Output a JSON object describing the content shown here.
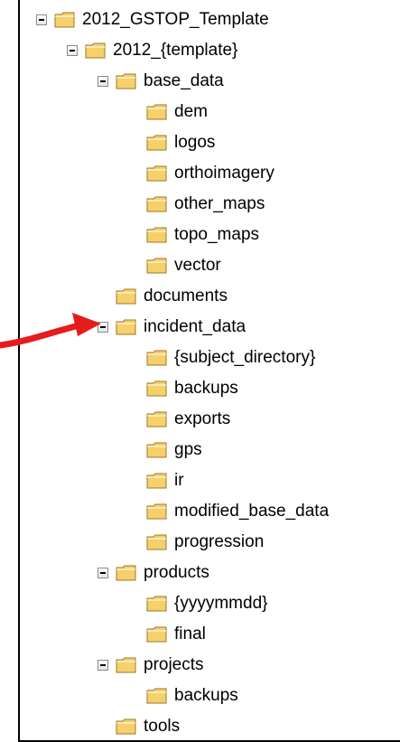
{
  "colors": {
    "arrow": "#e61b1b",
    "folder_fill": "#f6d06b",
    "folder_stroke": "#9a7a27"
  },
  "tree": [
    {
      "label": "2012_GSTOP_Template",
      "depth": 0,
      "expanded": true
    },
    {
      "label": "2012_{template}",
      "depth": 1,
      "expanded": true
    },
    {
      "label": "base_data",
      "depth": 2,
      "expanded": true
    },
    {
      "label": "dem",
      "depth": 3,
      "expanded": false
    },
    {
      "label": "logos",
      "depth": 3,
      "expanded": false
    },
    {
      "label": "orthoimagery",
      "depth": 3,
      "expanded": false
    },
    {
      "label": "other_maps",
      "depth": 3,
      "expanded": false
    },
    {
      "label": "topo_maps",
      "depth": 3,
      "expanded": false
    },
    {
      "label": "vector",
      "depth": 3,
      "expanded": false
    },
    {
      "label": "documents",
      "depth": 2,
      "expanded": false
    },
    {
      "label": "incident_data",
      "depth": 2,
      "expanded": true
    },
    {
      "label": "{subject_directory}",
      "depth": 3,
      "expanded": false
    },
    {
      "label": "backups",
      "depth": 3,
      "expanded": false
    },
    {
      "label": "exports",
      "depth": 3,
      "expanded": false
    },
    {
      "label": "gps",
      "depth": 3,
      "expanded": false
    },
    {
      "label": "ir",
      "depth": 3,
      "expanded": false
    },
    {
      "label": "modified_base_data",
      "depth": 3,
      "expanded": false
    },
    {
      "label": "progression",
      "depth": 3,
      "expanded": false
    },
    {
      "label": "products",
      "depth": 2,
      "expanded": true
    },
    {
      "label": "{yyyymmdd}",
      "depth": 3,
      "expanded": false
    },
    {
      "label": "final",
      "depth": 3,
      "expanded": false
    },
    {
      "label": "projects",
      "depth": 2,
      "expanded": true
    },
    {
      "label": "backups",
      "depth": 3,
      "expanded": false
    },
    {
      "label": "tools",
      "depth": 2,
      "expanded": false
    }
  ]
}
